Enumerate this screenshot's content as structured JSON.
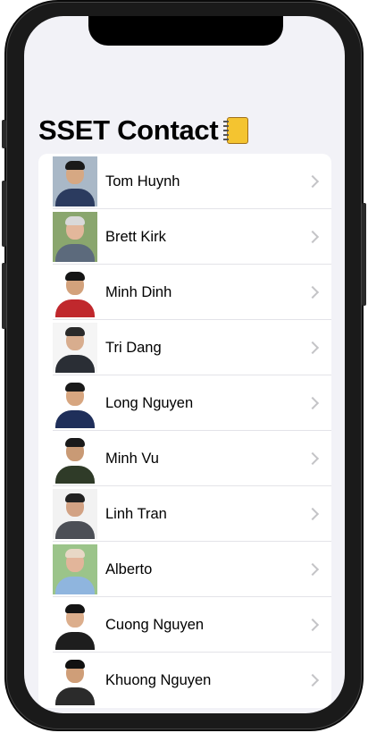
{
  "page": {
    "title": "SSET Contact"
  },
  "contacts": [
    {
      "name": "Tom Huynh",
      "bg": "#a9b8c7",
      "skin": "#d6a883",
      "hair": "#1a1a1a",
      "shirt": "#2b3b5f"
    },
    {
      "name": "Brett Kirk",
      "bg": "#8aa66e",
      "skin": "#e3b79b",
      "hair": "#d9d9d9",
      "shirt": "#5c6a7c"
    },
    {
      "name": "Minh Dinh",
      "bg": "#ffffff",
      "skin": "#d3a27c",
      "hair": "#151515",
      "shirt": "#c0282d"
    },
    {
      "name": "Tri Dang",
      "bg": "#f5f5f5",
      "skin": "#d8ad8e",
      "hair": "#2a2a2a",
      "shirt": "#2a2e35"
    },
    {
      "name": "Long Nguyen",
      "bg": "#ffffff",
      "skin": "#d7a680",
      "hair": "#1a1a1a",
      "shirt": "#1f2f5a"
    },
    {
      "name": "Minh Vu",
      "bg": "#ffffff",
      "skin": "#c99a75",
      "hair": "#1a1a1a",
      "shirt": "#2f3b28"
    },
    {
      "name": "Linh Tran",
      "bg": "#f2f2f2",
      "skin": "#d2a284",
      "hair": "#222222",
      "shirt": "#4c4f56"
    },
    {
      "name": "Alberto",
      "bg": "#9bc48a",
      "skin": "#e2b59a",
      "hair": "#e8d8c6",
      "shirt": "#8fb5de"
    },
    {
      "name": "Cuong Nguyen",
      "bg": "#ffffff",
      "skin": "#dcae8c",
      "hair": "#141414",
      "shirt": "#1e1e1e"
    },
    {
      "name": "Khuong Nguyen",
      "bg": "#ffffff",
      "skin": "#cf9e78",
      "hair": "#111111",
      "shirt": "#2b2b2b"
    }
  ]
}
